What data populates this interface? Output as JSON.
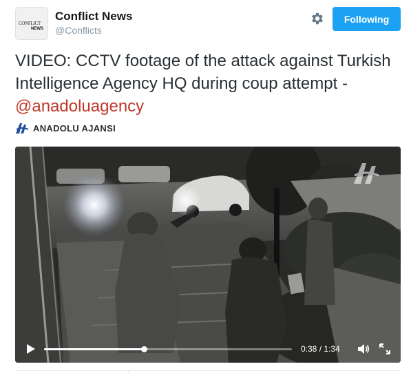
{
  "account": {
    "display_name": "Conflict News",
    "handle": "@Conflicts",
    "avatar_text_1": "CONFLICT",
    "avatar_text_2": "NEWS"
  },
  "follow_button": {
    "label": "Following"
  },
  "tweet": {
    "text": "VIDEO: CCTV footage of the attack against Turkish Intelligence Agency  HQ during coup attempt - ",
    "mention": "@anadoluagency"
  },
  "source": {
    "name": "ANADOLU AJANSI",
    "icon": "anadolu-logo-icon"
  },
  "video": {
    "time_label": "0:38 / 1:34",
    "progress": 0.404,
    "icons": {
      "play": "play-icon",
      "volume": "volume-icon",
      "fullscreen": "fullscreen-icon",
      "watermark": "aa-watermark-icon"
    }
  },
  "colors": {
    "accent": "#1da1f2",
    "mention": "#c0392b",
    "handle": "#8899a6",
    "text": "#292f33"
  }
}
